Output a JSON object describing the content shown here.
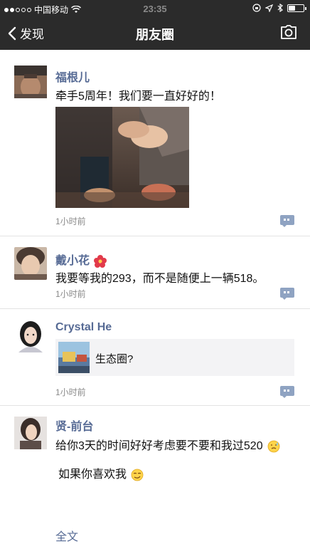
{
  "status_bar": {
    "carrier": "中国移动",
    "time": "23:35"
  },
  "nav": {
    "back_label": "发现",
    "title": "朋友圈"
  },
  "posts": [
    {
      "name": "福根儿",
      "text": "牵手5周年！我们要一直好好的！",
      "time": "1小时前"
    },
    {
      "name": "戴小花",
      "text": "我要等我的293，而不是随便上一辆518。",
      "time": "1小时前"
    },
    {
      "name": "Crystal He",
      "link_title": "生态圈?",
      "time": "1小时前"
    },
    {
      "name": "贤-前台",
      "text": "给你3天的时间好好考虑要不要和我过520",
      "text2": "如果你喜欢我",
      "more": "全文"
    }
  ],
  "colors": {
    "nav_bg": "#2b2b2b",
    "name_link": "#576b95",
    "time_gray": "#8a8a8a"
  }
}
